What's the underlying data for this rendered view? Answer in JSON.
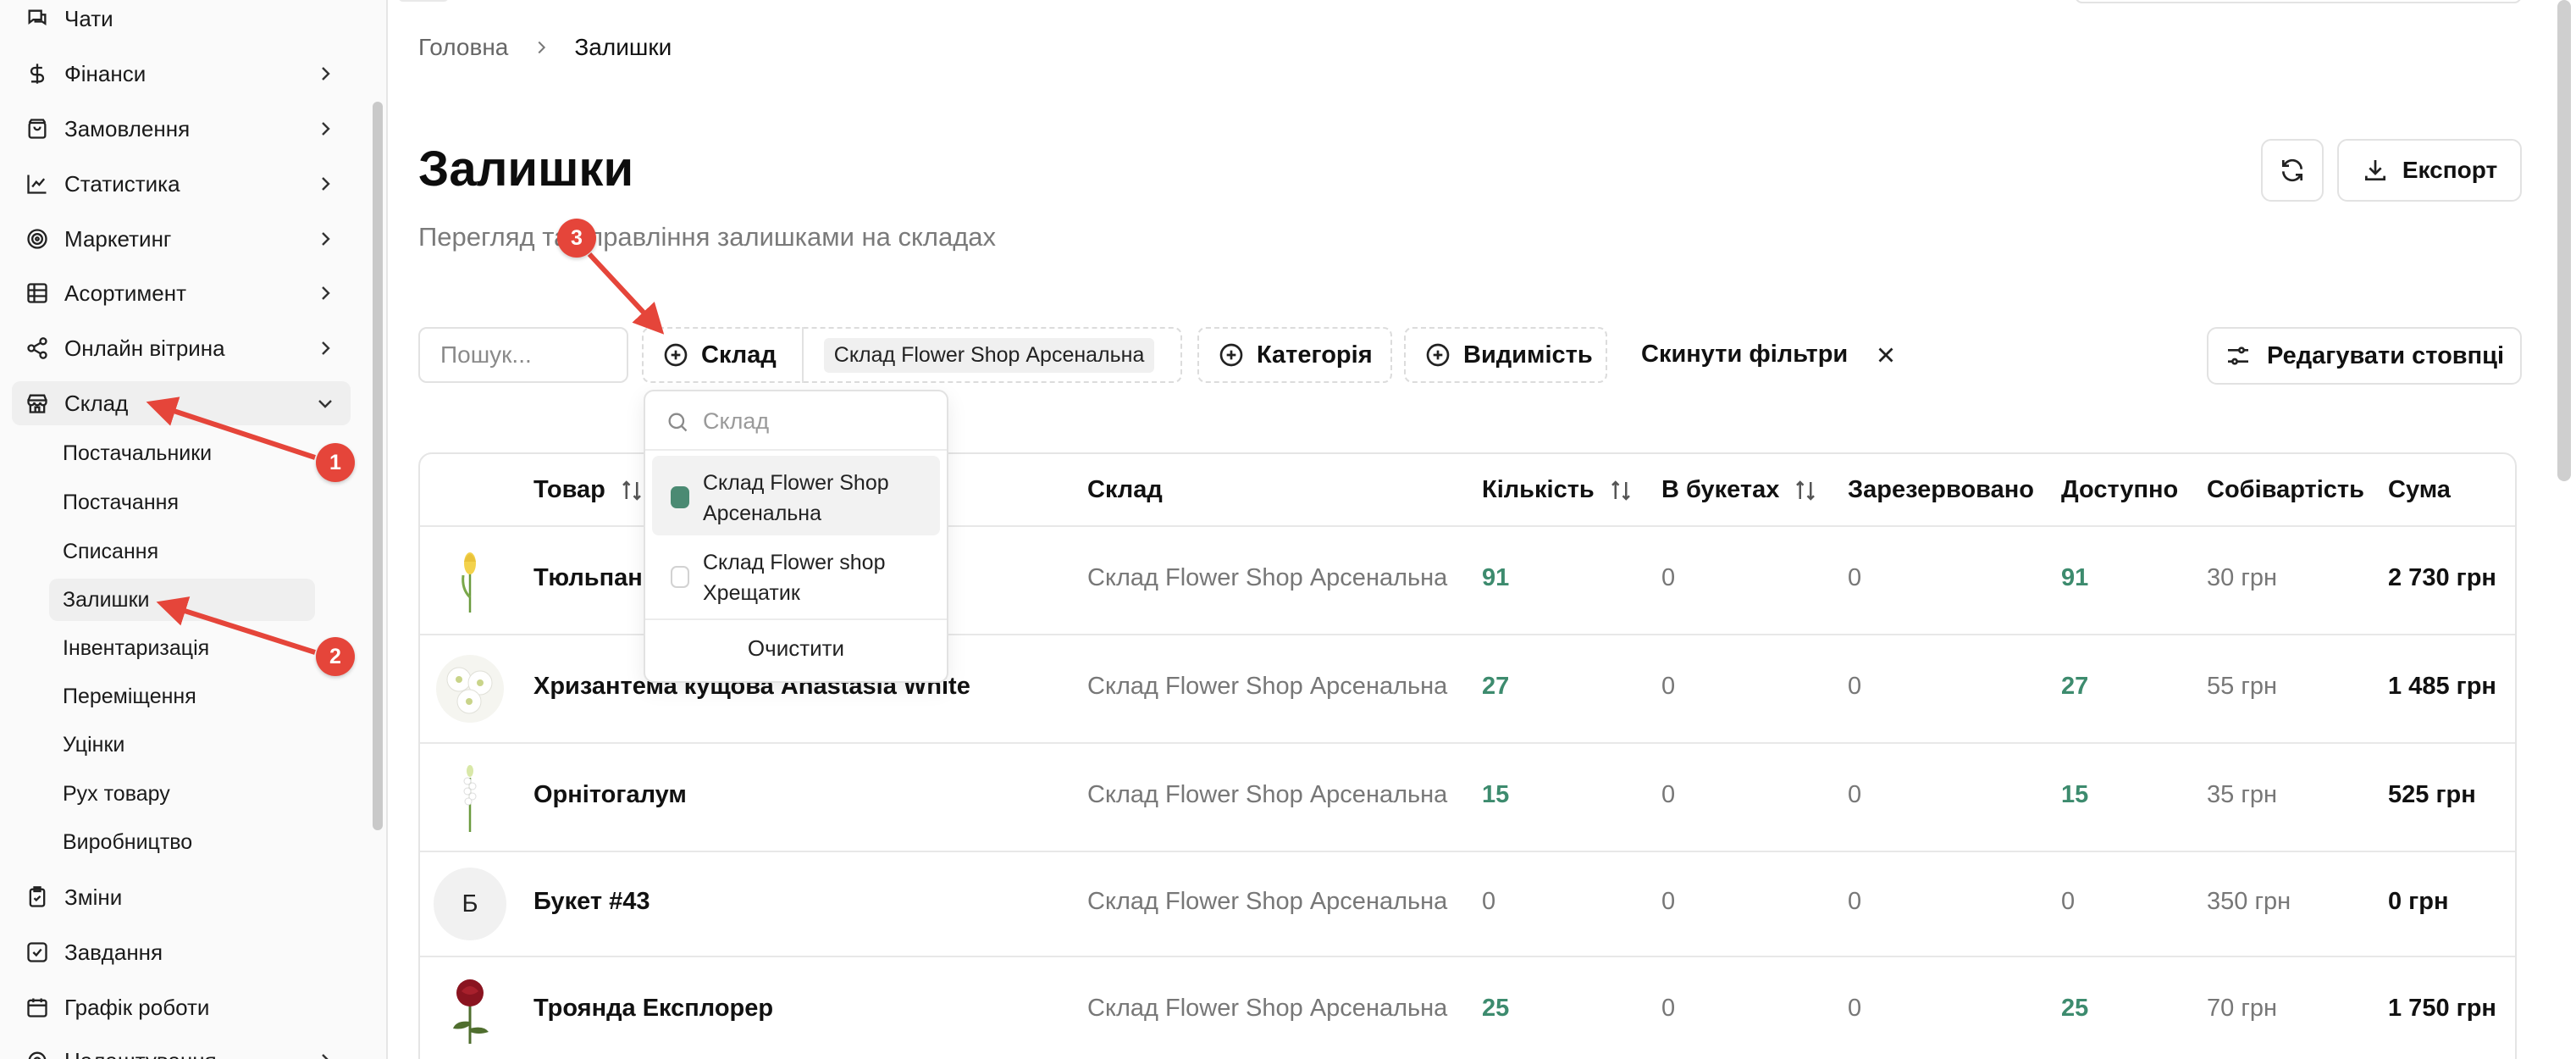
{
  "sidebar": {
    "items": [
      {
        "label": "Чати",
        "icon": "chat-icon",
        "chevron": false
      },
      {
        "label": "Фінанси",
        "icon": "dollar-icon",
        "chevron": true
      },
      {
        "label": "Замовлення",
        "icon": "shopping-bag-icon",
        "chevron": true
      },
      {
        "label": "Статистика",
        "icon": "line-chart-icon",
        "chevron": true
      },
      {
        "label": "Маркетинг",
        "icon": "target-icon",
        "chevron": true
      },
      {
        "label": "Асортимент",
        "icon": "grid-table-icon",
        "chevron": true
      },
      {
        "label": "Онлайн вітрина",
        "icon": "share-icon",
        "chevron": true
      },
      {
        "label": "Склад",
        "icon": "store-icon",
        "chevron": "down"
      },
      {
        "label": "Зміни",
        "icon": "clipboard-check-icon",
        "chevron": false
      },
      {
        "label": "Завдання",
        "icon": "check-square-icon",
        "chevron": false
      },
      {
        "label": "Графік роботи",
        "icon": "calendar-icon",
        "chevron": false
      },
      {
        "label": "Налаштування",
        "icon": "settings-icon",
        "chevron": true
      }
    ],
    "sub_items": [
      "Постачальники",
      "Постачання",
      "Списання",
      "Залишки",
      "Інвентаризація",
      "Переміщення",
      "Уцінки",
      "Рух товару",
      "Виробництво"
    ]
  },
  "breadcrumb": {
    "home": "Головна",
    "current": "Залишки"
  },
  "page": {
    "title": "Залишки",
    "subtitle": "Перегляд та управління залишками на складах"
  },
  "actions": {
    "export_label": "Експорт"
  },
  "filters": {
    "search_placeholder": "Пошук...",
    "warehouse_label": "Склад",
    "warehouse_selected": "Склад Flower Shop Арсенальна",
    "category_label": "Категорія",
    "visibility_label": "Видимість",
    "reset_label": "Скинути фільтри",
    "edit_columns_label": "Редагувати стовпці"
  },
  "dropdown": {
    "search_placeholder": "Склад",
    "options": [
      {
        "label": "Склад Flower Shop Арсенальна",
        "checked": true
      },
      {
        "label": "Склад Flower shop Хрещатик",
        "checked": false
      }
    ],
    "clear_label": "Очистити"
  },
  "table": {
    "columns": [
      "Товар",
      "Склад",
      "Кількість",
      "В букетах",
      "Зарезервовано",
      "Доступно",
      "Собівартість",
      "Сума"
    ],
    "rows": [
      {
        "name": "Тюльпан",
        "warehouse": "Склад Flower Shop Арсенальна",
        "qty": "91",
        "in_bouquets": "0",
        "reserved": "0",
        "available": "91",
        "cost": "30 грн",
        "sum": "2 730 грн",
        "thumb": "tulip"
      },
      {
        "name": "Хризантема кущова Anastasia White",
        "warehouse": "Склад Flower Shop Арсенальна",
        "qty": "27",
        "in_bouquets": "0",
        "reserved": "0",
        "available": "27",
        "cost": "55 грн",
        "sum": "1 485 грн",
        "thumb": "chrysanthemum"
      },
      {
        "name": "Орнітогалум",
        "warehouse": "Склад Flower Shop Арсенальна",
        "qty": "15",
        "in_bouquets": "0",
        "reserved": "0",
        "available": "15",
        "cost": "35 грн",
        "sum": "525 грн",
        "thumb": "ornithogalum"
      },
      {
        "name": "Букет #43",
        "warehouse": "Склад Flower Shop Арсенальна",
        "qty": "0",
        "in_bouquets": "0",
        "reserved": "0",
        "available": "0",
        "cost": "350 грн",
        "sum": "0 грн",
        "thumb": "Б"
      },
      {
        "name": "Троянда Експлорер",
        "warehouse": "Склад Flower Shop Арсенальна",
        "qty": "25",
        "in_bouquets": "0",
        "reserved": "0",
        "available": "25",
        "cost": "70 грн",
        "sum": "1 750 грн",
        "thumb": "rose"
      }
    ]
  },
  "annotations": [
    "1",
    "2",
    "3"
  ],
  "colors": {
    "accent_green": "#3d8b6e",
    "annotation_red": "#e5453a",
    "muted_text": "#777777"
  }
}
